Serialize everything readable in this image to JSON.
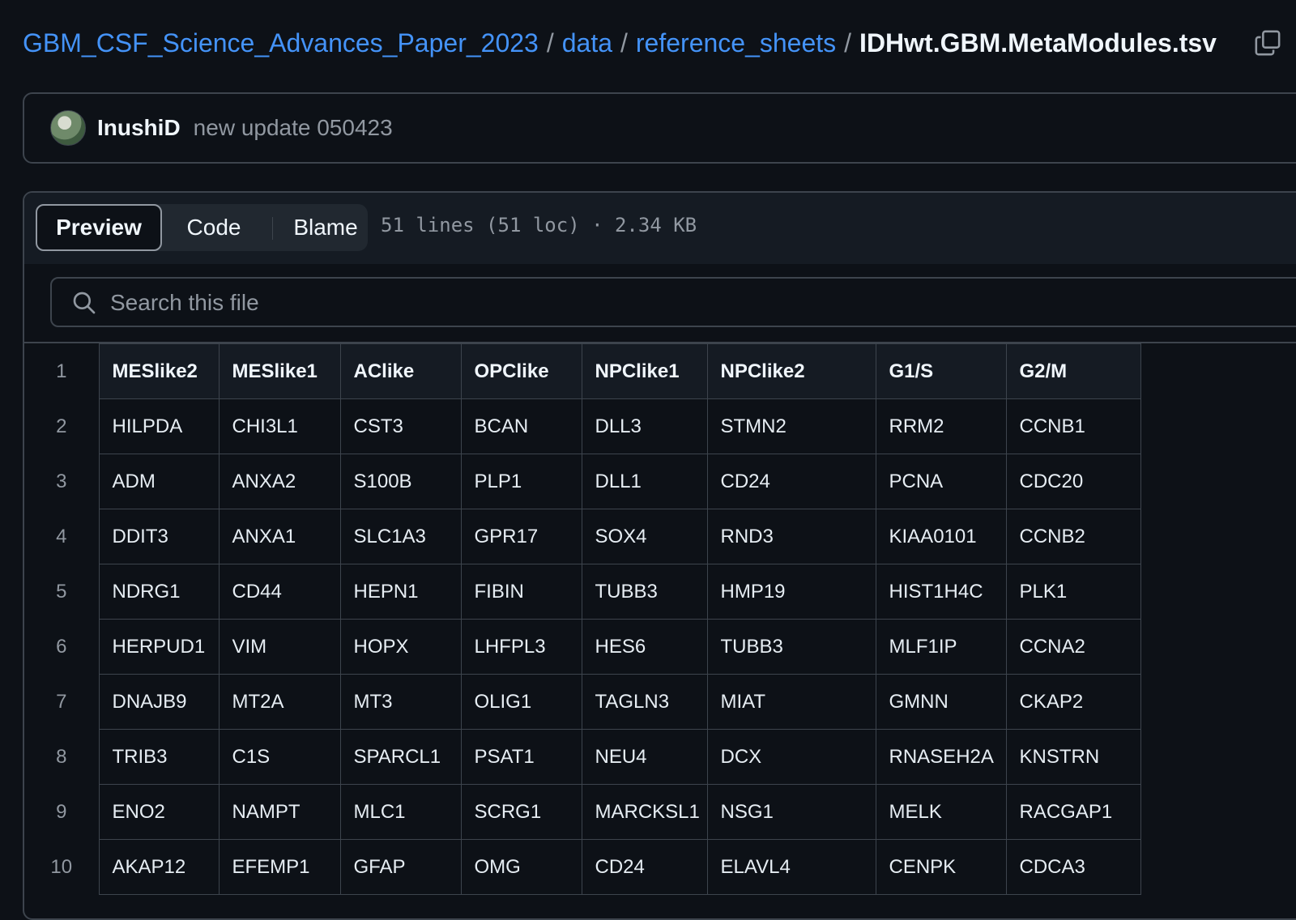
{
  "breadcrumb": {
    "repo": "GBM_CSF_Science_Advances_Paper_2023",
    "folder1": "data",
    "folder2": "reference_sheets",
    "file": "IDHwt.GBM.MetaModules.tsv",
    "separator": "/"
  },
  "commit": {
    "author": "InushiD",
    "message": "new update 050423"
  },
  "tabs": {
    "preview": "Preview",
    "code": "Code",
    "blame": "Blame"
  },
  "file_info": "51 lines (51 loc) · 2.34 KB",
  "search": {
    "placeholder": "Search this file"
  },
  "table": {
    "headers": [
      "MESlike2",
      "MESlike1",
      "AClike",
      "OPClike",
      "NPClike1",
      "NPClike2",
      "G1/S",
      "G2/M"
    ],
    "rows": [
      {
        "line": "1",
        "cells": [
          "MESlike2",
          "MESlike1",
          "AClike",
          "OPClike",
          "NPClike1",
          "NPClike2",
          "G1/S",
          "G2/M"
        ]
      },
      {
        "line": "2",
        "cells": [
          "HILPDA",
          "CHI3L1",
          "CST3",
          "BCAN",
          "DLL3",
          "STMN2",
          "RRM2",
          "CCNB1"
        ]
      },
      {
        "line": "3",
        "cells": [
          "ADM",
          "ANXA2",
          "S100B",
          "PLP1",
          "DLL1",
          "CD24",
          "PCNA",
          "CDC20"
        ]
      },
      {
        "line": "4",
        "cells": [
          "DDIT3",
          "ANXA1",
          "SLC1A3",
          "GPR17",
          "SOX4",
          "RND3",
          "KIAA0101",
          "CCNB2"
        ]
      },
      {
        "line": "5",
        "cells": [
          "NDRG1",
          "CD44",
          "HEPN1",
          "FIBIN",
          "TUBB3",
          "HMP19",
          "HIST1H4C",
          "PLK1"
        ]
      },
      {
        "line": "6",
        "cells": [
          "HERPUD1",
          "VIM",
          "HOPX",
          "LHFPL3",
          "HES6",
          "TUBB3",
          "MLF1IP",
          "CCNA2"
        ]
      },
      {
        "line": "7",
        "cells": [
          "DNAJB9",
          "MT2A",
          "MT3",
          "OLIG1",
          "TAGLN3",
          "MIAT",
          "GMNN",
          "CKAP2"
        ]
      },
      {
        "line": "8",
        "cells": [
          "TRIB3",
          "C1S",
          "SPARCL1",
          "PSAT1",
          "NEU4",
          "DCX",
          "RNASEH2A",
          "KNSTRN"
        ]
      },
      {
        "line": "9",
        "cells": [
          "ENO2",
          "NAMPT",
          "MLC1",
          "SCRG1",
          "MARCKSL1",
          "NSG1",
          "MELK",
          "RACGAP1"
        ]
      },
      {
        "line": "10",
        "cells": [
          "AKAP12",
          "EFEMP1",
          "GFAP",
          "OMG",
          "CD24",
          "ELAVL4",
          "CENPK",
          "CDCA3"
        ]
      }
    ]
  },
  "icons": {
    "copy": "copy-icon",
    "search": "search-icon"
  },
  "colors": {
    "background": "#0d1117",
    "link": "#4493f8",
    "border": "#3d444d",
    "muted": "#9198a1"
  }
}
